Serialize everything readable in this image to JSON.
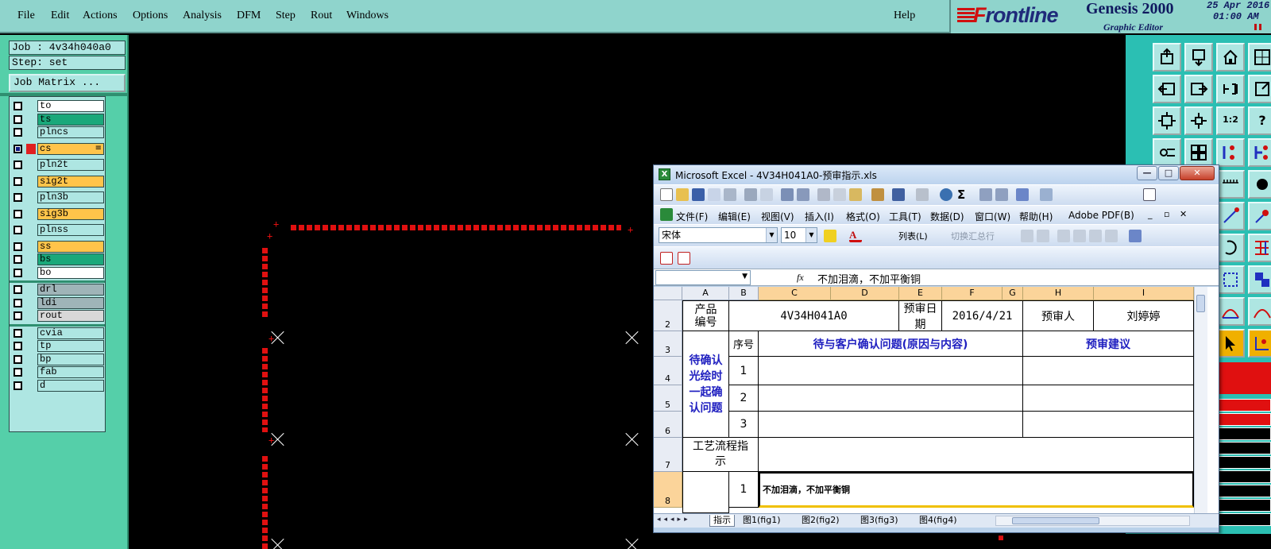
{
  "menubar": {
    "items": [
      "File",
      "Edit",
      "Actions",
      "Options",
      "Analysis",
      "DFM",
      "Step",
      "Rout",
      "Windows"
    ],
    "help": "Help"
  },
  "brand": {
    "logo_first": "F",
    "logo_rest": "rontline",
    "product": "Genesis 2000",
    "subtitle": "Graphic Editor",
    "date": "25 Apr 2016",
    "time": "01:00 AM"
  },
  "job": {
    "job_label": "Job : 4v34h040a0",
    "step_label": "Step: set",
    "matrix_button": "Job Matrix ..."
  },
  "layers": [
    {
      "name": "to",
      "color": "#ffffff",
      "checked": false
    },
    {
      "name": "ts",
      "color": "#1aa87a",
      "checked": false
    },
    {
      "name": "plncs",
      "color": "#aee6e2",
      "checked": false
    },
    {
      "name": "cs",
      "color": "#ffc44a",
      "checked": true,
      "active": true
    },
    {
      "name": "pln2t",
      "color": "#aee6e2",
      "checked": false
    },
    {
      "name": "sig2t",
      "color": "#ffc44a",
      "checked": false
    },
    {
      "name": "pln3b",
      "color": "#aee6e2",
      "checked": false
    },
    {
      "name": "sig3b",
      "color": "#ffc44a",
      "checked": false
    },
    {
      "name": "plnss",
      "color": "#aee6e2",
      "checked": false
    },
    {
      "name": "ss",
      "color": "#ffc44a",
      "checked": false
    },
    {
      "name": "bs",
      "color": "#1aa87a",
      "checked": false
    },
    {
      "name": "bo",
      "color": "#ffffff",
      "checked": false
    },
    {
      "name": "drl",
      "color": "#9fb4b8",
      "checked": false
    },
    {
      "name": "ldi",
      "color": "#9fb4b8",
      "checked": false
    },
    {
      "name": "rout",
      "color": "#d8d8d8",
      "checked": false
    },
    {
      "name": "cvia",
      "color": "#aee6e2",
      "checked": false
    },
    {
      "name": "tp",
      "color": "#aee6e2",
      "checked": false
    },
    {
      "name": "bp",
      "color": "#aee6e2",
      "checked": false
    },
    {
      "name": "fab",
      "color": "#aee6e2",
      "checked": false
    },
    {
      "name": "d",
      "color": "#aee6e2",
      "checked": false
    }
  ],
  "excel": {
    "title": "Microsoft Excel - 4V34H041A0-预审指示.xls",
    "menu": [
      "文件(F)",
      "编辑(E)",
      "视图(V)",
      "插入(I)",
      "格式(O)",
      "工具(T)",
      "数据(D)",
      "窗口(W)",
      "帮助(H)",
      "Adobe PDF(B)"
    ],
    "font_name": "宋体",
    "font_size": "10",
    "list_label": "列表(L)",
    "toggle_total": "切换汇总行",
    "formula": "不加泪滴，不加平衡铜",
    "columns": [
      "A",
      "B",
      "C",
      "D",
      "E",
      "F",
      "G",
      "H",
      "I"
    ],
    "rows": [
      "2",
      "3",
      "4",
      "5",
      "6",
      "7",
      "8"
    ],
    "cells": {
      "product_no_label": "产品\n编号",
      "product_no": "4V34H041A0",
      "review_date_label": "预审日期",
      "review_date": "2016/4/21",
      "reviewer_label": "预审人",
      "reviewer": "刘婷婷",
      "seq_label": "序号",
      "confirm_header": "待与客户确认问题(原因与内容)",
      "advice_header": "预审建议",
      "pending_label": "待确认光绘时一起确认问题",
      "n1": "1",
      "n2": "2",
      "n3": "3",
      "process_label": "工艺流程指示",
      "p1": "1",
      "p1_text": "不加泪滴，不加平衡铜"
    },
    "tabs": [
      "指示",
      "图1(fig1)",
      "图2(fig2)",
      "图3(fig3)",
      "图4(fig4)"
    ]
  },
  "right_toolbar": {
    "ratio_label": "1:2",
    "help_label": "?"
  }
}
